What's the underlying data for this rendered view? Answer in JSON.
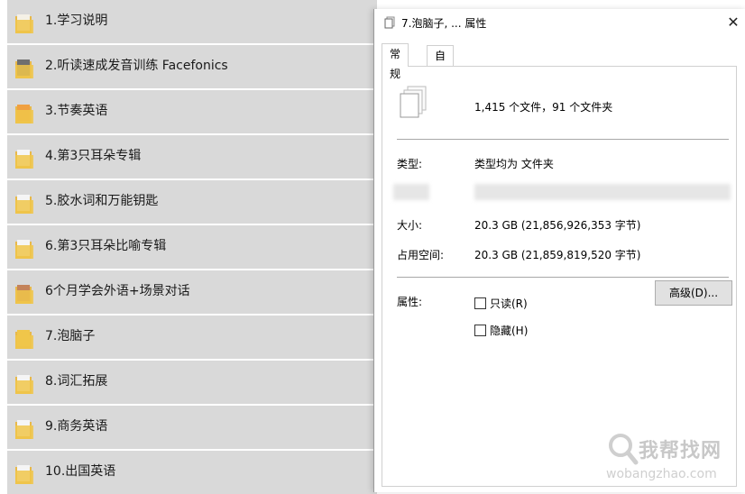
{
  "folders": [
    {
      "label": "1.学习说明"
    },
    {
      "label": "2.听读速成发音训练 Facefonics"
    },
    {
      "label": "3.节奏英语"
    },
    {
      "label": "4.第3只耳朵专辑"
    },
    {
      "label": "5.胶水词和万能钥匙"
    },
    {
      "label": "6.第3只耳朵比喻专辑"
    },
    {
      "label": "6个月学会外语+场景对话"
    },
    {
      "label": "7.泡脑子"
    },
    {
      "label": "8.词汇拓展"
    },
    {
      "label": "9.商务英语"
    },
    {
      "label": "10.出国英语"
    }
  ],
  "dialog": {
    "title": "7.泡脑子, ... 属性",
    "close": "✕",
    "tabs": [
      {
        "label": "常规"
      },
      {
        "label": "自定义"
      }
    ],
    "summary": "1,415 个文件，91 个文件夹",
    "type_label": "类型:",
    "type_value": "类型均为 文件夹",
    "size_label": "大小:",
    "size_value": "20.3 GB (21,856,926,353 字节)",
    "disk_label": "占用空间:",
    "disk_value": "20.3 GB (21,859,819,520 字节)",
    "attr_label": "属性:",
    "readonly_label": "只读(R)",
    "hidden_label": "隐藏(H)",
    "advanced_label": "高级(D)..."
  },
  "watermark": {
    "main": "我帮找网",
    "sub": "wobangzhao.com"
  },
  "colors": {
    "row_bg": "#d9d9d9",
    "folder_yellow": "#f0c64a"
  }
}
